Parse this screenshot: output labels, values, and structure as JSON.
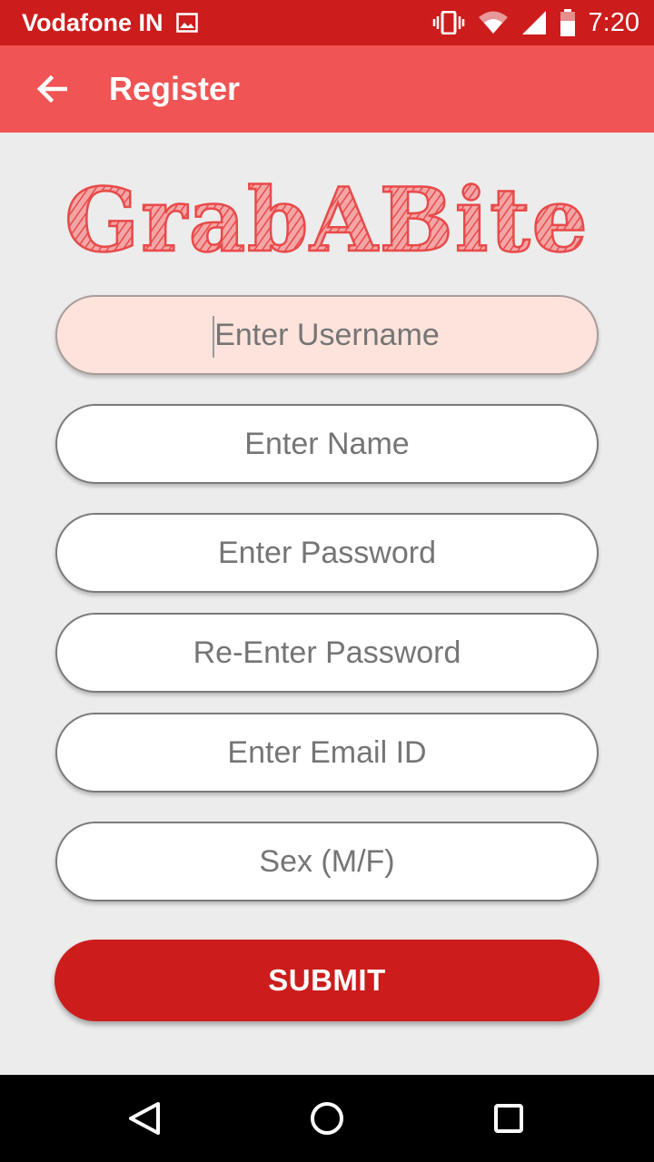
{
  "status_bar": {
    "carrier": "Vodafone IN",
    "time": "7:20",
    "icons": [
      "image-notification-icon",
      "vibrate-icon",
      "wifi-icon",
      "cell-signal-icon",
      "battery-icon"
    ]
  },
  "app_bar": {
    "title": "Register",
    "back_icon": "arrow-back-icon"
  },
  "logo": {
    "text": "GrabABite",
    "color": "#e84a4a"
  },
  "form": {
    "username": {
      "placeholder": "Enter Username",
      "value": ""
    },
    "name": {
      "placeholder": "Enter Name",
      "value": ""
    },
    "password": {
      "placeholder": "Enter Password",
      "value": ""
    },
    "reenter_password": {
      "placeholder": "Re-Enter Password",
      "value": ""
    },
    "email": {
      "placeholder": "Enter Email ID",
      "value": ""
    },
    "sex": {
      "placeholder": "Sex (M/F)",
      "value": ""
    },
    "submit_label": "SUBMIT"
  },
  "nav_bar": {
    "icons": [
      "back-triangle-icon",
      "home-circle-icon",
      "recents-square-icon"
    ]
  },
  "colors": {
    "status_bar": "#cc1c1c",
    "app_bar": "#f05454",
    "accent": "#cc1c1c",
    "focused_field": "#fee3dc",
    "background": "#ececec"
  }
}
